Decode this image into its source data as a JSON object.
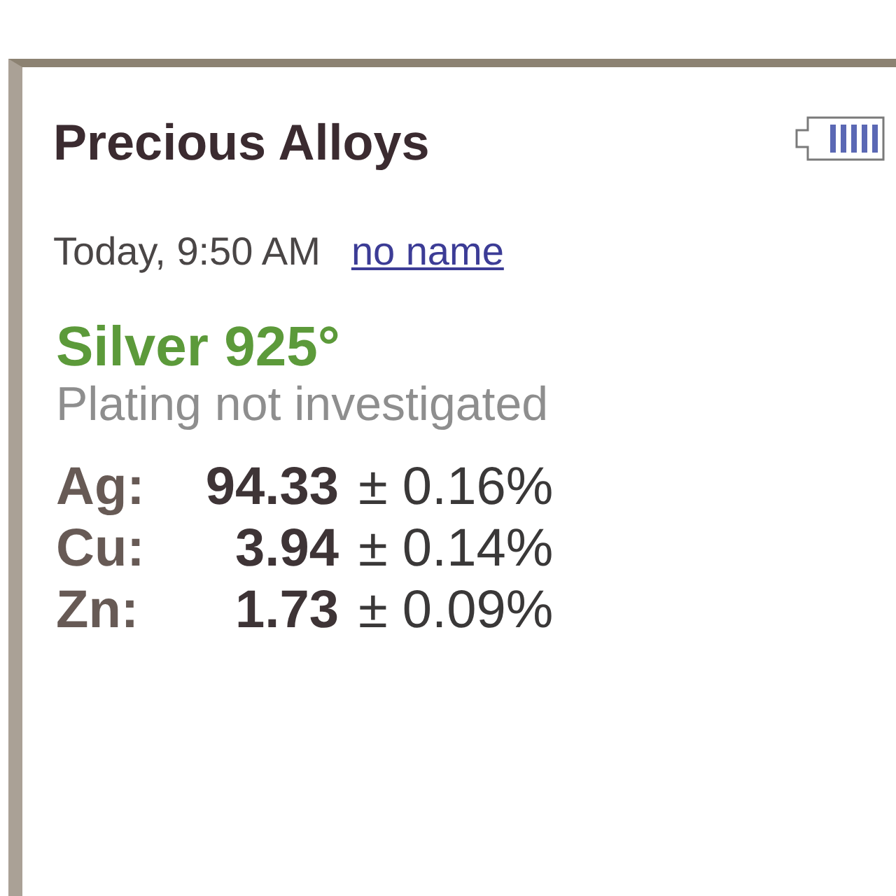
{
  "header": {
    "title": "Precious Alloys"
  },
  "measurement": {
    "time": "Today, 9:50 AM",
    "sample_name": "no name"
  },
  "result": {
    "grade": "Silver 925°",
    "note": "Plating not investigated",
    "elements": [
      {
        "symbol": "Ag:",
        "value": "94.33",
        "uncertainty": "± 0.16%"
      },
      {
        "symbol": "Cu:",
        "value": "3.94",
        "uncertainty": "± 0.14%"
      },
      {
        "symbol": "Zn:",
        "value": "1.73",
        "uncertainty": "± 0.09%"
      }
    ]
  }
}
